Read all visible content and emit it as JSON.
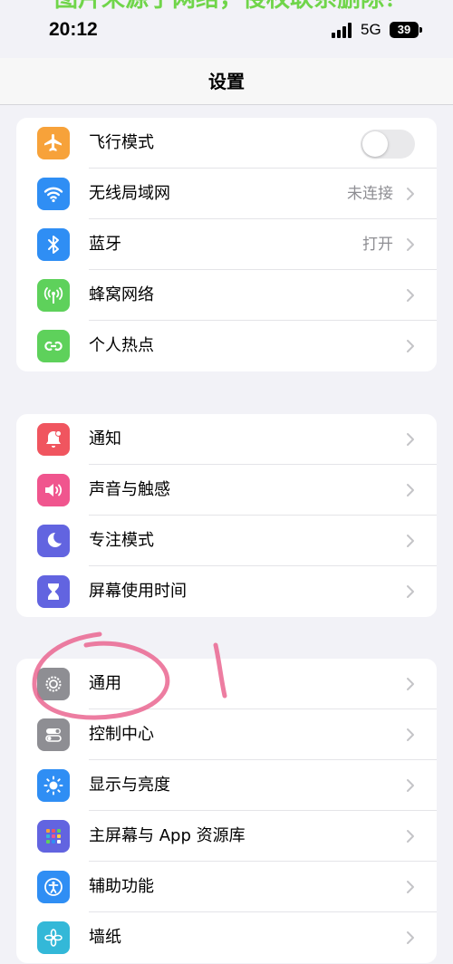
{
  "status": {
    "time": "20:12",
    "network": "5G",
    "battery": "39"
  },
  "watermark": "图片来源于网络，侵权联系删除！",
  "header": {
    "title": "设置"
  },
  "colors": {
    "airplane": "#f7a23a",
    "wifi": "#2f8ef4",
    "bluetooth": "#2f8ef4",
    "cellular": "#5ed15b",
    "hotspot": "#5ed15b",
    "notifications": "#f0555f",
    "sounds": "#f0558e",
    "focus": "#6264e0",
    "screen_time": "#6264e0",
    "general": "#8e8e93",
    "control_center": "#8e8e93",
    "display": "#2f8ef4",
    "home_screen": "#6264e0",
    "accessibility": "#2f8ef4",
    "wallpaper": "#33b8d8"
  },
  "groups": [
    {
      "items": [
        {
          "label": "飞行模式",
          "icon": "airplane-icon",
          "toggle": false
        },
        {
          "label": "无线局域网",
          "icon": "wifi-icon",
          "value": "未连接"
        },
        {
          "label": "蓝牙",
          "icon": "bluetooth-icon",
          "value": "打开"
        },
        {
          "label": "蜂窝网络",
          "icon": "cellular-icon"
        },
        {
          "label": "个人热点",
          "icon": "hotspot-icon"
        }
      ]
    },
    {
      "items": [
        {
          "label": "通知",
          "icon": "bell-icon"
        },
        {
          "label": "声音与触感",
          "icon": "speaker-icon"
        },
        {
          "label": "专注模式",
          "icon": "moon-icon"
        },
        {
          "label": "屏幕使用时间",
          "icon": "hourglass-icon"
        }
      ]
    },
    {
      "items": [
        {
          "label": "通用",
          "icon": "gear-icon"
        },
        {
          "label": "控制中心",
          "icon": "toggles-icon"
        },
        {
          "label": "显示与亮度",
          "icon": "sun-icon"
        },
        {
          "label": "主屏幕与 App 资源库",
          "icon": "app-grid-icon"
        },
        {
          "label": "辅助功能",
          "icon": "accessibility-icon"
        },
        {
          "label": "墙纸",
          "icon": "flower-icon"
        }
      ]
    }
  ]
}
